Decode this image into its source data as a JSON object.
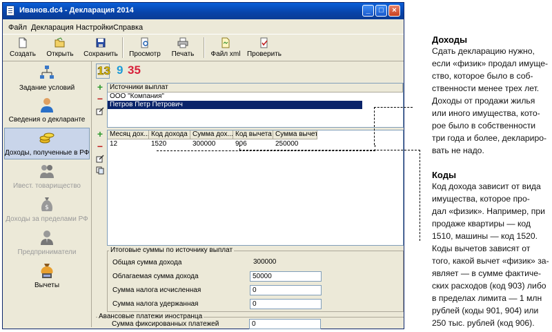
{
  "window": {
    "title": "Иванов.dc4 - Декларация 2014",
    "controls": {
      "minimize": "_",
      "maximize": "□",
      "close": "×"
    }
  },
  "menu": [
    "Файл",
    "Декларация",
    "Настройки",
    "Справка"
  ],
  "toolbar": [
    {
      "label": "Создать",
      "icon": "new-document-icon"
    },
    {
      "label": "Открыть",
      "icon": "open-folder-icon"
    },
    {
      "label": "Сохранить",
      "icon": "save-disk-icon"
    },
    {
      "label": "Просмотр",
      "icon": "preview-icon"
    },
    {
      "label": "Печать",
      "icon": "printer-icon"
    },
    {
      "label": "Файл xml",
      "icon": "xml-file-icon"
    },
    {
      "label": "Проверить",
      "icon": "check-icon"
    }
  ],
  "sidebar": [
    {
      "label": "Задание условий",
      "icon": "conditions-network-icon",
      "state": "normal"
    },
    {
      "label": "Сведения о декларанте",
      "icon": "person-icon",
      "state": "normal"
    },
    {
      "label": "Доходы, полученные в РФ",
      "icon": "coins-icon",
      "state": "active"
    },
    {
      "label": "Ивест. товарищество",
      "icon": "investors-icon",
      "state": "disabled"
    },
    {
      "label": "Доходы за пределами РФ",
      "icon": "money-bag-icon",
      "state": "disabled"
    },
    {
      "label": "Предприниматели",
      "icon": "businessman-icon",
      "state": "disabled"
    },
    {
      "label": "Вычеты",
      "icon": "deductions-icon",
      "state": "normal"
    }
  ],
  "rate_tabs": [
    "13",
    "9",
    "35"
  ],
  "sources": {
    "header": "Источники выплат",
    "rows": [
      "ООО \"Компания\"",
      "Петров Петр Петрович"
    ],
    "selected_index": 1
  },
  "income_table": {
    "columns": [
      "Месяц дох...",
      "Код дохода",
      "Сумма дох...",
      "Код вычета",
      "Сумма вычета"
    ],
    "rows": [
      [
        "12",
        "1520",
        "300000",
        "906",
        "250000"
      ]
    ]
  },
  "totals": {
    "legend": "Итоговые суммы по источнику выплат",
    "fields": [
      {
        "label": "Общая сумма дохода",
        "value": "300000",
        "readonly": true
      },
      {
        "label": "Облагаемая сумма дохода",
        "value": "50000",
        "readonly": false
      },
      {
        "label": "Сумма налога исчисленная",
        "value": "0",
        "readonly": false
      },
      {
        "label": "Сумма налога удержанная",
        "value": "0",
        "readonly": false
      }
    ]
  },
  "advance": {
    "legend": "Авансовые платежи иностранца",
    "label": "Сумма фиксированных платежей",
    "value": "0"
  },
  "annotations": [
    {
      "title": "Доходы",
      "lines": [
        "Сдать декларацию нужно,",
        "если «физик» продал имуще-",
        "ство, которое было в соб-",
        "ственности менее трех лет.",
        "Доходы от продажи жилья",
        "или иного имущества, кото-",
        "рое было в собственности",
        "три года и более, деклариро-",
        "вать не надо."
      ]
    },
    {
      "title": "Коды",
      "lines": [
        "Код дохода зависит от вида",
        "имущества, которое про-",
        "дал «физик». Например, при",
        "продаже квартиры — код",
        "1510, машины — код 1520.",
        "Коды вычетов зависят от",
        "того, какой вычет «физик» за-",
        "являет — в сумме фактиче-",
        "ских расходов (код 903) либо",
        "в пределах лимита — 1 млн",
        "рублей (коды 901, 904) или",
        "250 тыс. рублей (код 906)."
      ]
    }
  ],
  "colors": {
    "titlebar": "#0a4fc4",
    "selection": "#0a246a",
    "rate13": "#e8c400",
    "rate9": "#1e9bd7",
    "rate35": "#d8203a"
  }
}
